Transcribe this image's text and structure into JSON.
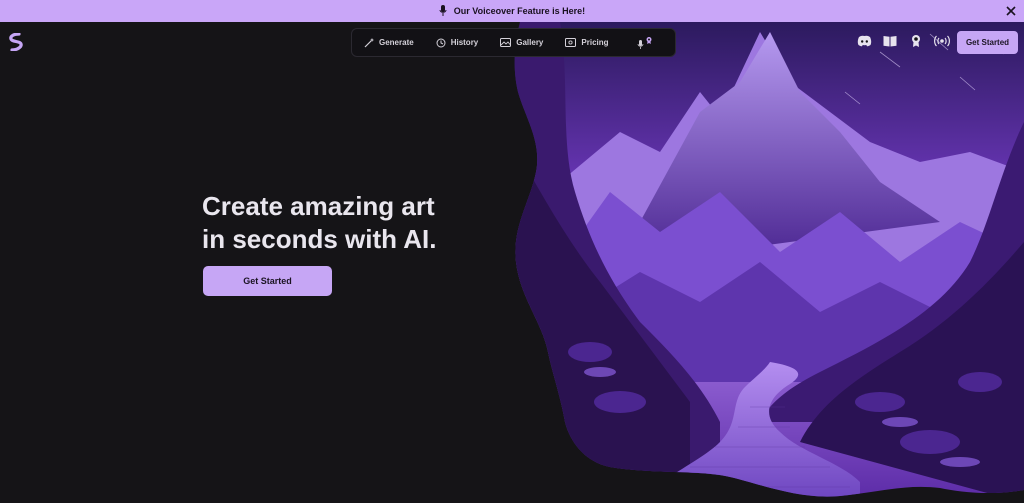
{
  "banner": {
    "text": "Our Voiceover Feature is Here!",
    "icon": "microphone-icon",
    "close_icon": "close-icon"
  },
  "logo": {
    "icon": "logo-mark-icon"
  },
  "nav": {
    "items": [
      {
        "label": "Generate",
        "icon": "magic-wand-icon"
      },
      {
        "label": "History",
        "icon": "history-clock-icon"
      },
      {
        "label": "Gallery",
        "icon": "image-gallery-icon"
      },
      {
        "label": "Pricing",
        "icon": "pricing-card-icon"
      }
    ],
    "voice_icon": "microphone-badge-icon"
  },
  "header_icons": [
    "discord-icon",
    "book-icon",
    "award-icon",
    "broadcast-icon"
  ],
  "header_button": {
    "label": "Get Started"
  },
  "hero": {
    "line1": "Create amazing art",
    "line2": "in seconds with AI.",
    "cta_label": "Get Started"
  },
  "colors": {
    "background": "#151417",
    "banner": "#c9a6f8",
    "accent": "#c6a6f5",
    "art_purple": "#7a3fd1"
  }
}
